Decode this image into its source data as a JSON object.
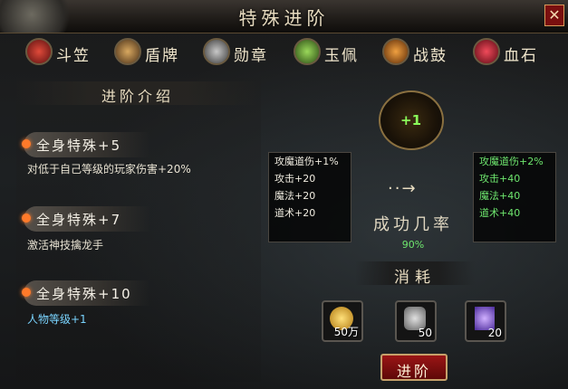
{
  "window": {
    "title": "特殊进阶",
    "close_label": "✕"
  },
  "tabs": [
    {
      "label": "斗笠",
      "icon": "hat-icon",
      "color": "#b5322a"
    },
    {
      "label": "盾牌",
      "icon": "shield-icon",
      "color": "#b0884a"
    },
    {
      "label": "勋章",
      "icon": "medal-icon",
      "color": "#8a8a8a"
    },
    {
      "label": "玉佩",
      "icon": "jade-icon",
      "color": "#6a9a3a"
    },
    {
      "label": "战鼓",
      "icon": "drum-icon",
      "color": "#c0762a"
    },
    {
      "label": "血石",
      "icon": "bloodstone-icon",
      "color": "#c02a3a"
    }
  ],
  "intro": {
    "heading": "进阶介绍",
    "entries": [
      {
        "title": "全身特殊+5",
        "desc": "对低于自己等级的玩家伤害+20%",
        "desc_color": "#e8e2d2"
      },
      {
        "title": "全身特殊+7",
        "desc": "激活神技擒龙手",
        "desc_color": "#e8e2d2"
      },
      {
        "title": "全身特殊+10",
        "desc": "人物等级+1",
        "desc_color": "#7ad4ff"
      }
    ]
  },
  "current_stats": [
    "攻魔道伤+1%",
    "攻击+20",
    "魔法+20",
    "道术+20"
  ],
  "next_stats": [
    "攻魔道伤+2%",
    "攻击+40",
    "魔法+40",
    "道术+40"
  ],
  "item_preview": {
    "level_label": "+1"
  },
  "success": {
    "arrow": "··→",
    "label": "成功几率",
    "rate": "90%"
  },
  "cost": {
    "heading": "消耗",
    "items": [
      {
        "icon": "gold-coin-icon",
        "qty": "50万"
      },
      {
        "icon": "ore-icon",
        "qty": "50"
      },
      {
        "icon": "crystal-icon",
        "qty": "20"
      }
    ]
  },
  "advance_button": "进阶",
  "colors": {
    "accent_red": "#9a1515",
    "gold": "#c6a06a",
    "green": "#6ee66e",
    "text": "#e8dcc0"
  }
}
